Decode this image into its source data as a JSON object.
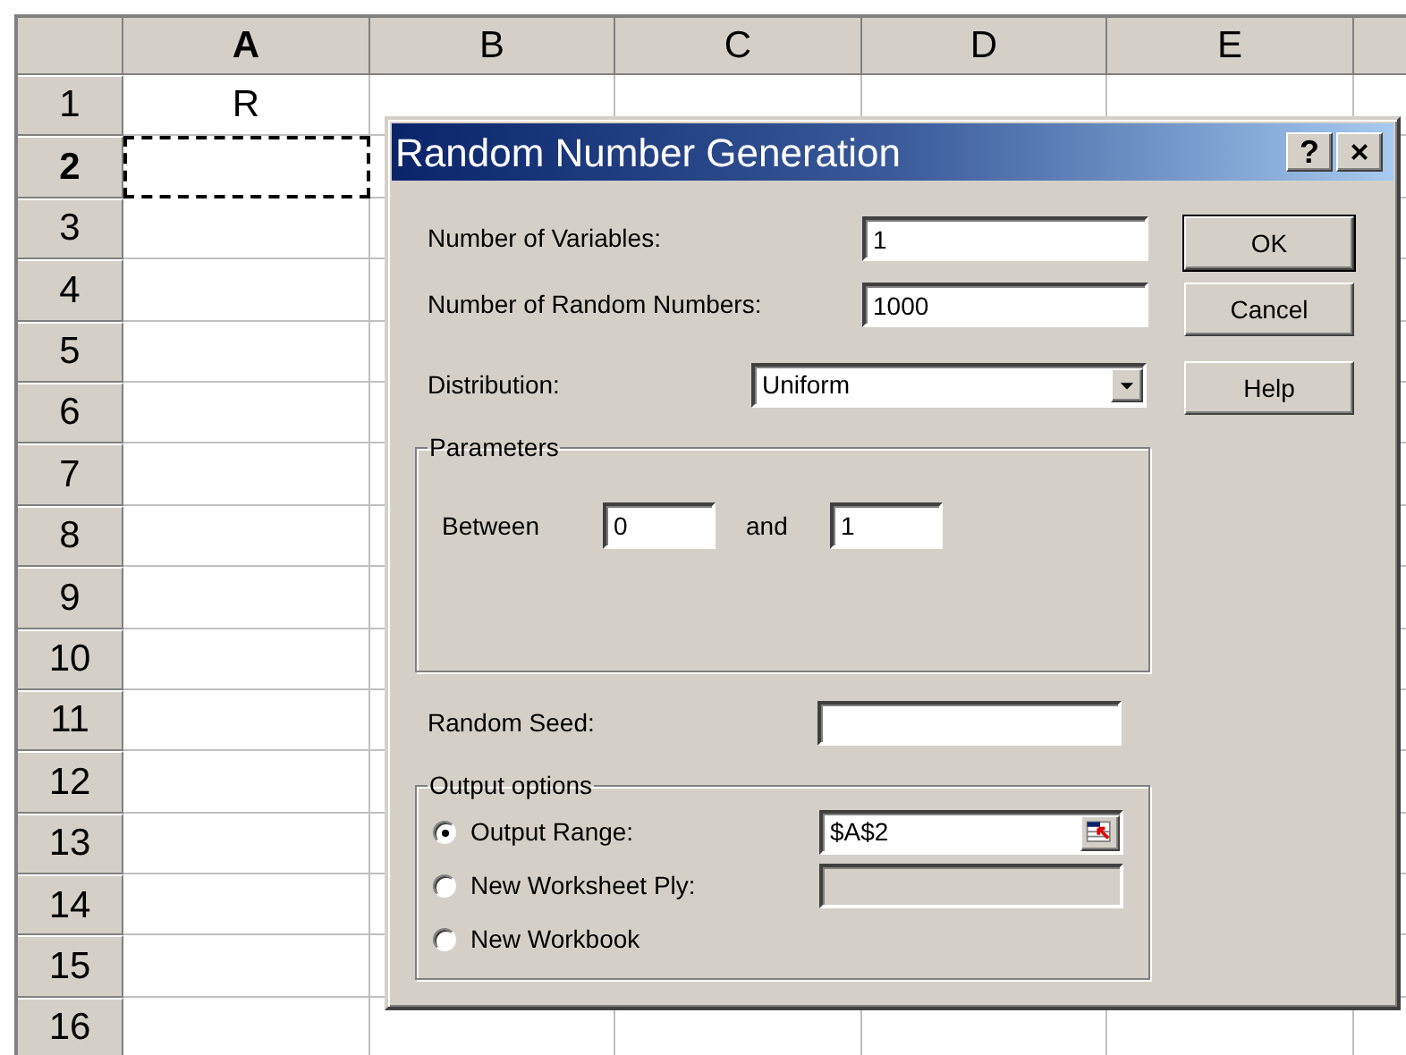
{
  "sheet": {
    "columns": [
      {
        "label": "A",
        "selected": true
      },
      {
        "label": "B",
        "selected": false
      },
      {
        "label": "C",
        "selected": false
      },
      {
        "label": "D",
        "selected": false
      },
      {
        "label": "E",
        "selected": false
      }
    ],
    "rows": [
      {
        "label": "1",
        "selected": false,
        "marquee": false,
        "cell_a": "R"
      },
      {
        "label": "2",
        "selected": true,
        "marquee": true
      },
      {
        "label": "3",
        "selected": false,
        "marquee": false
      },
      {
        "label": "4",
        "selected": false,
        "marquee": false
      },
      {
        "label": "5",
        "selected": false,
        "marquee": false
      },
      {
        "label": "6",
        "selected": false,
        "marquee": false
      },
      {
        "label": "7",
        "selected": false,
        "marquee": false
      },
      {
        "label": "8",
        "selected": false,
        "marquee": false
      },
      {
        "label": "9",
        "selected": false,
        "marquee": false
      },
      {
        "label": "10",
        "selected": false,
        "marquee": false
      },
      {
        "label": "11",
        "selected": false,
        "marquee": false
      },
      {
        "label": "12",
        "selected": false,
        "marquee": false
      },
      {
        "label": "13",
        "selected": false,
        "marquee": false
      },
      {
        "label": "14",
        "selected": false,
        "marquee": false
      },
      {
        "label": "15",
        "selected": false,
        "marquee": false
      },
      {
        "label": "16",
        "selected": false,
        "marquee": false
      }
    ]
  },
  "dialog": {
    "title": "Random Number Generation",
    "title_buttons": [
      "?",
      "×"
    ],
    "fields": [
      {
        "label": "Number of Variables:",
        "value": "1"
      },
      {
        "label": "Number of Random Numbers:",
        "value": "1000"
      }
    ],
    "distribution": {
      "label": "Distribution:",
      "value": "Uniform"
    },
    "parameters": {
      "title": "Parameters",
      "between_label": "Between",
      "from": "0",
      "and_label": "and",
      "to": "1"
    },
    "random_seed": {
      "label": "Random Seed:"
    },
    "output": {
      "title": "Output options",
      "options": [
        {
          "label": "Output Range:",
          "selected": true,
          "kind": "range",
          "value": "$A$2"
        },
        {
          "label": "New Worksheet Ply:",
          "selected": false,
          "kind": "disabled-field"
        },
        {
          "label": "New Workbook",
          "selected": false,
          "kind": "plain"
        }
      ]
    },
    "buttons": [
      {
        "label": "OK",
        "default": true
      },
      {
        "label": "Cancel",
        "default": false
      },
      {
        "label": "Help",
        "default": false
      }
    ]
  }
}
